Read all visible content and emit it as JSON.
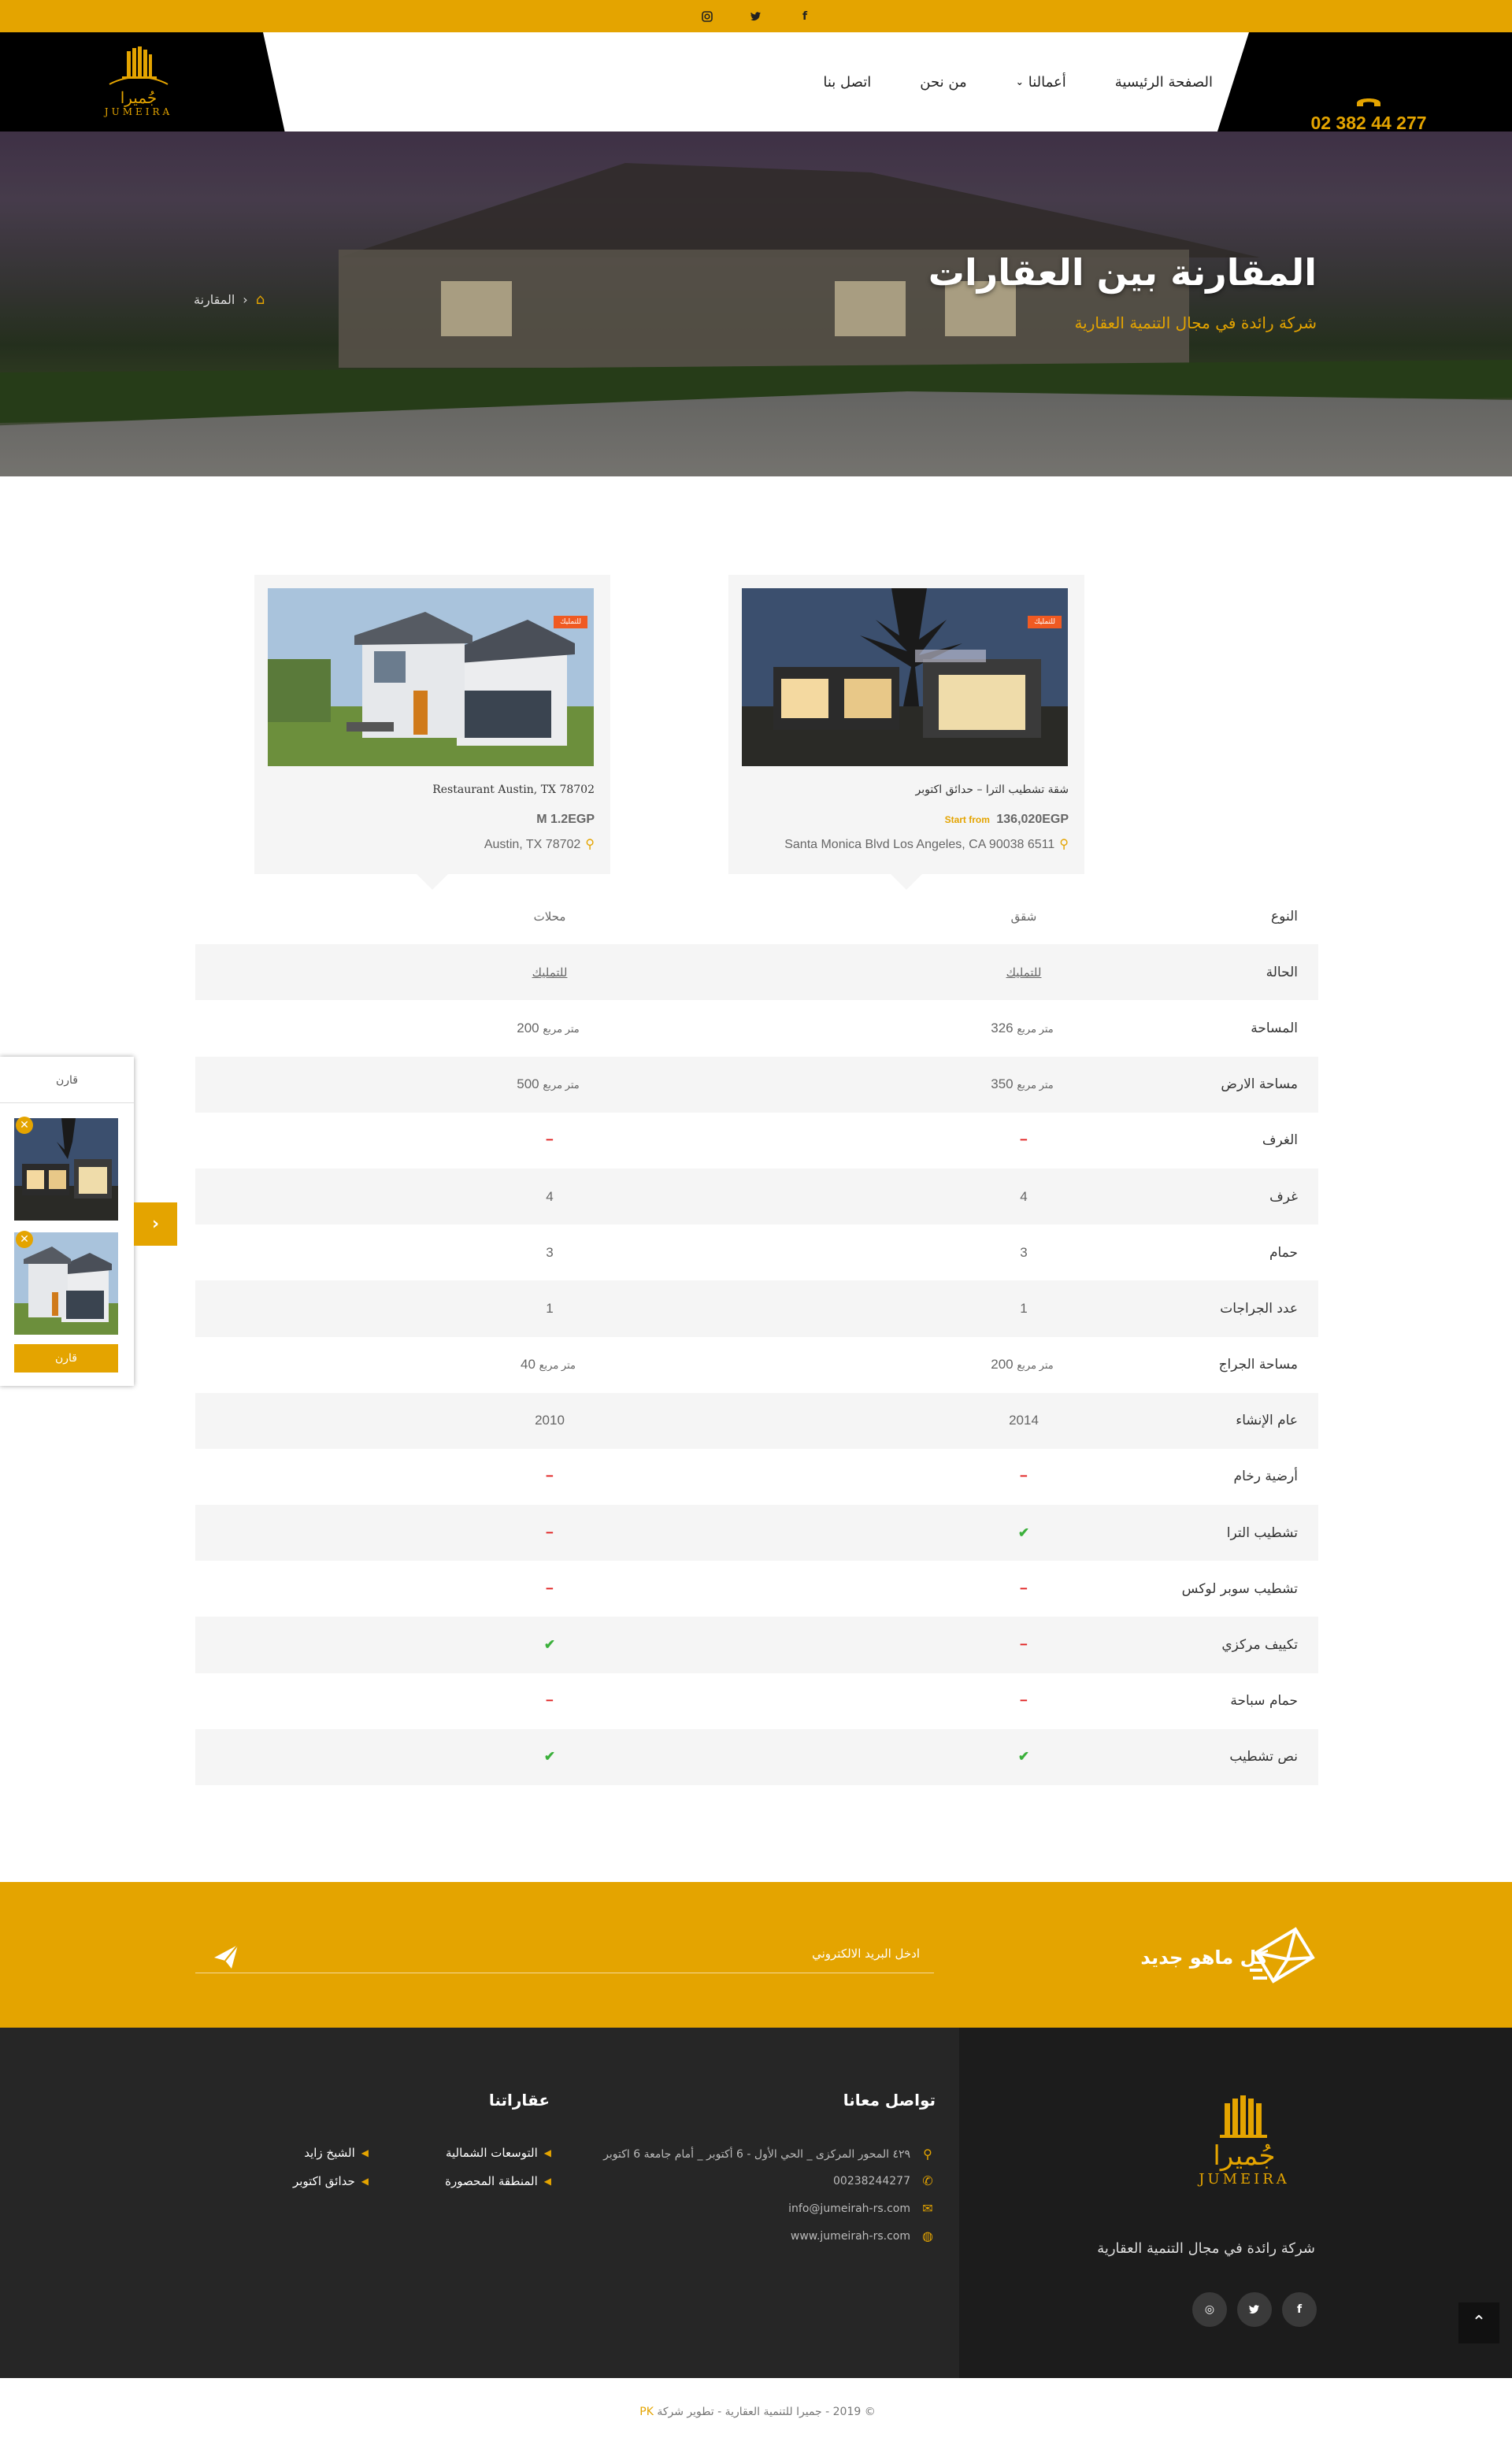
{
  "social": {
    "instagram": "◎",
    "twitter": "🐦",
    "facebook": "f"
  },
  "header": {
    "logo_ar": "جُميرا",
    "logo_en": "JUMEIRA",
    "phone": "02 382 44 277",
    "nav": [
      "الصفحة الرئيسية",
      "أعمالنا",
      "من نحن",
      "اتصل بنا"
    ]
  },
  "hero": {
    "title": "المقارنة بين العقارات",
    "subtitle": "شركة رائدة في مجال التنمية العقارية",
    "breadcrumb": "المقارنة"
  },
  "cards": [
    {
      "badge": "للتمليك",
      "title": "شقة تشطيب الترا – حدائق اكتوبر",
      "price_prefix": "Start from",
      "price": "136,020EGP",
      "address": "Santa Monica Blvd Los Angeles, CA 90038 6511"
    },
    {
      "badge": "للتمليك",
      "title": "Restaurant Austin, TX 78702",
      "price_prefix": "",
      "price": "M 1.2EGP",
      "address": "Austin, TX 78702"
    }
  ],
  "compare": {
    "unit": "متر مربع",
    "rows": [
      {
        "label": "النوع",
        "v1": "شقق",
        "v2": "محلات"
      },
      {
        "label": "الحالة",
        "v1": "للتمليك",
        "v2": "للتمليك"
      },
      {
        "label": "المساحة",
        "v1": "326",
        "v2": "200"
      },
      {
        "label": "مساحة الارض",
        "v1": "350",
        "v2": "500"
      },
      {
        "label": "الغرف",
        "v1": "−",
        "v2": "−"
      },
      {
        "label": "غرف",
        "v1": "4",
        "v2": "4"
      },
      {
        "label": "حمام",
        "v1": "3",
        "v2": "3"
      },
      {
        "label": "عدد الجراجات",
        "v1": "1",
        "v2": "1"
      },
      {
        "label": "مساحة الجراج",
        "v1": "200",
        "v2": "40"
      },
      {
        "label": "عام الإنشاء",
        "v1": "2014",
        "v2": "2010"
      },
      {
        "label": "أرضية رخام",
        "v1": "−",
        "v2": "−"
      },
      {
        "label": "تشطيب الترا",
        "v1": "✔",
        "v2": "−"
      },
      {
        "label": "تشطيب سوبر لوكس",
        "v1": "−",
        "v2": "−"
      },
      {
        "label": "تكييف مركزي",
        "v1": "−",
        "v2": "✔"
      },
      {
        "label": "حمام سباحة",
        "v1": "−",
        "v2": "−"
      },
      {
        "label": "نص تشطيب",
        "v1": "✔",
        "v2": "✔"
      }
    ]
  },
  "side_panel": {
    "title": "قارن",
    "button": "قارن"
  },
  "newsletter": {
    "title": "كل ماهو جديد",
    "placeholder": "ادخل البريد الالكتروني"
  },
  "footer": {
    "logo_ar": "جُميرا",
    "logo_en": "JUMEIRA",
    "tagline": "شركة رائدة في مجال التنمية العقارية",
    "contact_title": "تواصل معانا",
    "address": "٤٢٩ المحور المركزى _ الحي الأول - 6 أكتوبر _ أمام جامعة 6 اكتوبر",
    "phone": "00238244277",
    "email": "info@jumeirah-rs.com",
    "website": "www.jumeirah-rs.com",
    "props_title": "عقاراتنا",
    "props": [
      "التوسعات الشمالية",
      "الشيخ زايد",
      "المنطقة المحصورة",
      "حدائق اكتوبر"
    ]
  },
  "copyright": {
    "text": "© 2019 - جميرا للتنمية العقارية - تطوير شركة",
    "company": "PK"
  }
}
